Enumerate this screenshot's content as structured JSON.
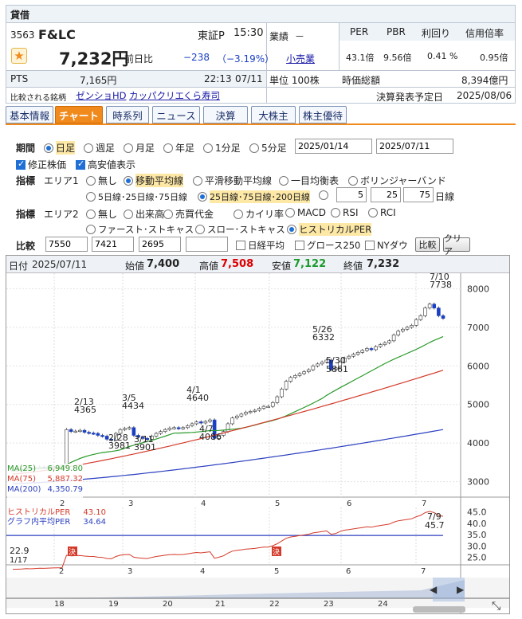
{
  "header": {
    "section": "貸借",
    "code": "3563",
    "name": "F&LC",
    "market": "東証P",
    "time": "15:30",
    "industry_label": "業績",
    "industry_value": "－",
    "sector_link": "小売業",
    "price": "7,232円",
    "change_label": "前日比",
    "change": "−238",
    "change_pct": "（−3.19%）",
    "pts_label": "PTS",
    "pts_price": "7,165円",
    "pts_time": "22:13",
    "pts_date": "07/11",
    "unit": "単位 100株",
    "compare_label": "比較される銘柄",
    "compare_links": [
      "ゼンショHD",
      "カッパクリエ",
      "くら寿司"
    ],
    "metrics_headers": [
      "PER",
      "PBR",
      "利回り",
      "信用倍率"
    ],
    "metrics_values": [
      "43.1倍",
      "9.56倍",
      "0.41 %",
      "0.95倍"
    ],
    "marketcap_label": "時価総額",
    "marketcap": "8,394億円",
    "earnings_label": "決算発表予定日",
    "earnings_date": "2025/08/06"
  },
  "tabs": [
    "基本情報",
    "チャート",
    "時系列",
    "ニュース",
    "決算",
    "大株主",
    "株主優待"
  ],
  "controls": {
    "period_label": "期間",
    "period_opts": [
      "日足",
      "週足",
      "月足",
      "年足",
      "1分足",
      "5分足"
    ],
    "from": "2025/01/14",
    "to": "2025/07/11",
    "adj_label": "修正株価",
    "hl_label": "高安値表示",
    "ind_label": "指標",
    "area1": "エリア1",
    "area1_opts": [
      "無し",
      "移動平均線",
      "平滑移動平均線",
      "一目均衡表",
      "ボリンジャーバンド"
    ],
    "ma_opt1": "5日線･25日線･75日線",
    "ma_opt2": "25日線･75日線･200日線",
    "ma_vals": [
      "5",
      "25",
      "75"
    ],
    "ma_unit": "日線",
    "area2": "エリア2",
    "area2_opts": [
      "無し",
      "出来高",
      "売買代金",
      "カイリ率",
      "MACD",
      "RSI",
      "RCI"
    ],
    "area2_opts_b": [
      "ファースト･ストキャス",
      "スロー･ストキャス",
      "ヒストリカルPER"
    ],
    "cmp_label": "比較",
    "cmp_vals": [
      "7550",
      "7421",
      "2695",
      ""
    ],
    "cmp_checks": [
      "日経平均",
      "グロース250",
      "NYダウ"
    ],
    "cmp_btn": "比較",
    "clear_btn": "クリア"
  },
  "chart_bar": {
    "date_label": "日付",
    "date": "2025/07/11",
    "open_label": "始値",
    "open": "7,400",
    "high_label": "高値",
    "high": "7,508",
    "low_label": "安値",
    "low": "7,122",
    "close_label": "終値",
    "close": "7,232"
  },
  "chart_legend": [
    "MA(25)",
    "6,949.80",
    "MA(75)",
    "5,887.32",
    "MA(200)",
    "4,350.79"
  ],
  "per_legend": [
    "ヒストリカルPER",
    "43.10",
    "グラフ内平均PER",
    "34.64"
  ],
  "per_annot": {
    "last_date": "7/9",
    "last": "45.7",
    "first": "22.9",
    "first_date": "1/17",
    "kessan": "決"
  },
  "chart_data": {
    "type": "line",
    "title": "",
    "yticks": [
      3000,
      4000,
      5000,
      6000,
      7000,
      8000
    ],
    "xticks": [
      "2",
      "3",
      "4",
      "5",
      "6",
      "7"
    ],
    "annotations": [
      {
        "date": "2/13",
        "value": 4365
      },
      {
        "date": "3/5",
        "value": 4434
      },
      {
        "date": "4/1",
        "value": 4640
      },
      {
        "date": "5/26",
        "value": 6332
      },
      {
        "date": "7/10",
        "value": 7738
      },
      {
        "date": "2/28",
        "value": 3981
      },
      {
        "date": "3/11",
        "value": 3901
      },
      {
        "date": "4/7",
        "value": 4086
      },
      {
        "date": "5/30",
        "value": 5861
      }
    ],
    "close": [
      3300,
      3310,
      3320,
      3350,
      3340,
      3360,
      3380,
      3370,
      3390,
      3400,
      3410,
      3420,
      4350,
      4300,
      4310,
      4330,
      4280,
      4260,
      4250,
      4200,
      4180,
      4100,
      4080,
      4250,
      4350,
      4380,
      4400,
      4200,
      4150,
      4120,
      4100,
      4180,
      4250,
      4300,
      4350,
      4390,
      4400,
      4380,
      4400,
      4450,
      4500,
      4550,
      4520,
      4560,
      4600,
      4120,
      4200,
      4300,
      4500,
      4650,
      4700,
      4750,
      4800,
      4820,
      4850,
      4900,
      4950,
      4950,
      5050,
      5200,
      5400,
      5600,
      5700,
      5750,
      5800,
      5850,
      5900,
      6000,
      6050,
      6100,
      6150,
      5900,
      5950,
      6100,
      6200,
      6250,
      6300,
      6350,
      6400,
      6450,
      6420,
      6500,
      6550,
      6600,
      6650,
      6800,
      6900,
      6950,
      7000,
      7050,
      7200,
      7300,
      7500,
      7600,
      7500,
      7300,
      7232
    ],
    "series": [
      {
        "name": "MA(25)",
        "last": 6949.8
      },
      {
        "name": "MA(75)",
        "last": 5887.32
      },
      {
        "name": "MA(200)",
        "last": 4350.79
      }
    ],
    "per": {
      "yticks": [
        25,
        30,
        35,
        40,
        45
      ],
      "avg": 34.64,
      "last": 43.1
    }
  },
  "colors": {
    "up": "#d00",
    "down": "#1a3fc4",
    "ma25": "#2a9a2a",
    "ma75": "#d43a2a",
    "ma200": "#2b3fbf",
    "accent": "#f08a1c"
  },
  "timeline_labels": [
    "18",
    "19",
    "20",
    "21",
    "22",
    "23",
    "24"
  ],
  "scroll_left": "◀",
  "scroll_right": "▶",
  "expand_icon": "expand-icon"
}
